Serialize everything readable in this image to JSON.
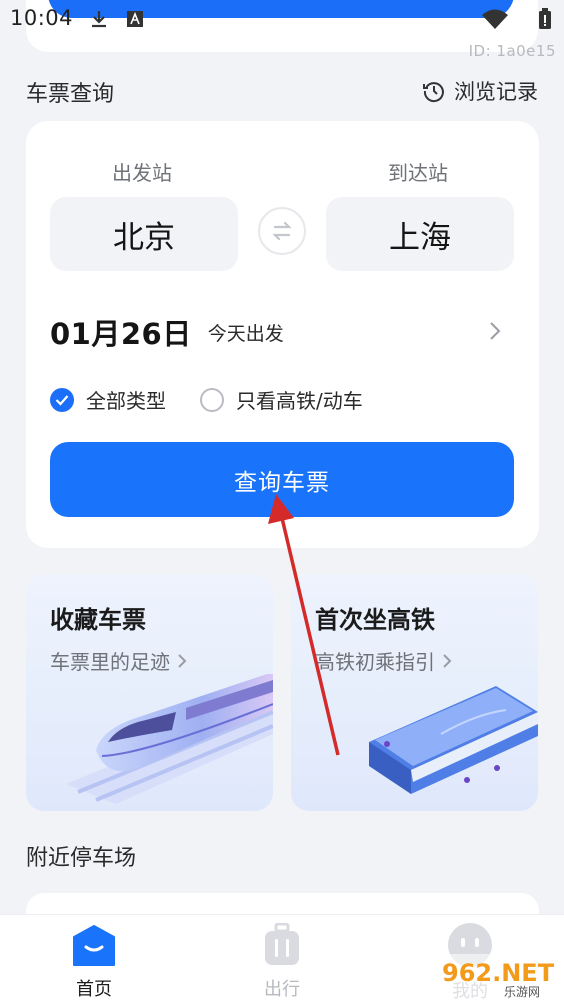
{
  "status_bar": {
    "time": "10:04"
  },
  "device_id": "ID: 1a0e15",
  "search": {
    "section_title": "车票查询",
    "history_label": "浏览记录",
    "from_label": "出发站",
    "to_label": "到达站",
    "from_station": "北京",
    "to_station": "上海",
    "date": "01月26日",
    "date_desc": "今天出发",
    "option_all": "全部类型",
    "option_all_checked": true,
    "option_high_speed": "只看高铁/动车",
    "option_high_speed_checked": false,
    "query_button": "查询车票"
  },
  "promos": [
    {
      "title": "收藏车票",
      "subtitle": "车票里的足迹"
    },
    {
      "title": "首次坐高铁",
      "subtitle": "高铁初乘指引"
    }
  ],
  "nearby": {
    "title": "附近停车场"
  },
  "tabs": [
    {
      "label": "首页",
      "active": true
    },
    {
      "label": "出行",
      "active": false
    },
    {
      "label": "我的",
      "active": false
    }
  ],
  "watermark": {
    "brand": "962.NET",
    "sub": "乐游网"
  },
  "colors": {
    "accent": "#1a74fb",
    "background": "#f2f3f7",
    "annotation_arrow": "#d42a2a"
  }
}
